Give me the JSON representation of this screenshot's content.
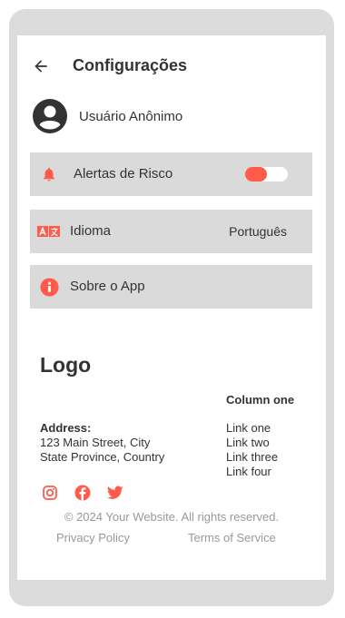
{
  "header": {
    "title": "Configurações",
    "back_icon": "arrow-left-icon"
  },
  "profile": {
    "avatar_icon": "user-circle-icon",
    "name": "Usuário Anônimo"
  },
  "settings": {
    "risk_alerts": {
      "label": "Alertas de Risco",
      "icon": "bell-icon",
      "enabled": true
    },
    "language": {
      "label": "Idioma",
      "icon": "translate-icon",
      "value": "Português"
    },
    "about": {
      "label": "Sobre o App",
      "icon": "info-icon"
    }
  },
  "footer": {
    "logo": "Logo",
    "column_title": "Column one",
    "address_label": "Address:",
    "address_line1": "123 Main Street, City",
    "address_line2": "State Province, Country",
    "links": [
      "Link one",
      "Link two",
      "Link three",
      "Link four"
    ],
    "social": [
      "instagram-icon",
      "facebook-icon",
      "twitter-icon"
    ],
    "copyright": "© 2024 Your Website. All rights reserved.",
    "privacy": "Privacy Policy",
    "terms": "Terms of Service"
  },
  "colors": {
    "accent": "#ff5a4a",
    "row_background": "#dadada",
    "frame": "#dcdcdc",
    "muted_text": "#999999",
    "text": "#333333"
  }
}
